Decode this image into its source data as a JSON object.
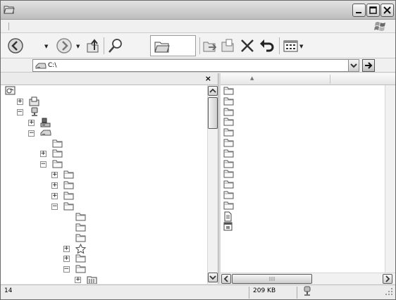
{
  "window": {
    "title": "",
    "icon": "folder-open-icon",
    "caption_buttons": [
      "minimize-icon",
      "maximize-icon",
      "close-icon"
    ]
  },
  "toolbar": {
    "buttons": [
      "back-icon",
      "forward-icon",
      "up-folder-icon",
      "search-icon",
      "folders-icon",
      "move-to-icon",
      "copy-to-icon",
      "delete-icon",
      "undo-icon",
      "views-icon"
    ]
  },
  "address": {
    "value": "C:\\",
    "icon": "drive-icon"
  },
  "left_pane": {
    "close_label": "×",
    "tree": [
      {
        "depth": 0,
        "expander": "",
        "icon": "desktop-icon"
      },
      {
        "depth": 1,
        "expander": "+",
        "icon": "documents-icon"
      },
      {
        "depth": 1,
        "expander": "−",
        "icon": "computer-icon"
      },
      {
        "depth": 2,
        "expander": "+",
        "icon": "floppy-icon"
      },
      {
        "depth": 2,
        "expander": "−",
        "icon": "drive-icon"
      },
      {
        "depth": 3,
        "expander": "",
        "icon": "folder-icon"
      },
      {
        "depth": 3,
        "expander": "+",
        "icon": "folder-icon"
      },
      {
        "depth": 3,
        "expander": "−",
        "icon": "folder-icon"
      },
      {
        "depth": 4,
        "expander": "+",
        "icon": "folder-icon"
      },
      {
        "depth": 4,
        "expander": "+",
        "icon": "folder-icon"
      },
      {
        "depth": 4,
        "expander": "+",
        "icon": "folder-icon"
      },
      {
        "depth": 4,
        "expander": "−",
        "icon": "folder-icon"
      },
      {
        "depth": 5,
        "expander": "",
        "icon": "folder-icon"
      },
      {
        "depth": 5,
        "expander": "",
        "icon": "folder-icon"
      },
      {
        "depth": 5,
        "expander": "",
        "icon": "folder-icon"
      },
      {
        "depth": 5,
        "expander": "+",
        "icon": "favorites-star-icon"
      },
      {
        "depth": 5,
        "expander": "+",
        "icon": "folder-icon"
      },
      {
        "depth": 5,
        "expander": "−",
        "icon": "folder-icon"
      },
      {
        "depth": 6,
        "expander": "+",
        "icon": "control-panel-icon"
      }
    ]
  },
  "right_pane": {
    "header_sort": "▲",
    "items": [
      {
        "icon": "folder-icon"
      },
      {
        "icon": "folder-icon"
      },
      {
        "icon": "folder-icon"
      },
      {
        "icon": "folder-icon"
      },
      {
        "icon": "folder-icon"
      },
      {
        "icon": "folder-icon"
      },
      {
        "icon": "folder-icon"
      },
      {
        "icon": "folder-icon"
      },
      {
        "icon": "folder-icon"
      },
      {
        "icon": "folder-icon"
      },
      {
        "icon": "folder-icon"
      },
      {
        "icon": "folder-icon"
      },
      {
        "icon": "text-file-icon"
      },
      {
        "icon": "system-file-icon"
      }
    ]
  },
  "status": {
    "object_count": "14",
    "size": "209 KB",
    "zone_icon": "computer-zone-icon"
  }
}
